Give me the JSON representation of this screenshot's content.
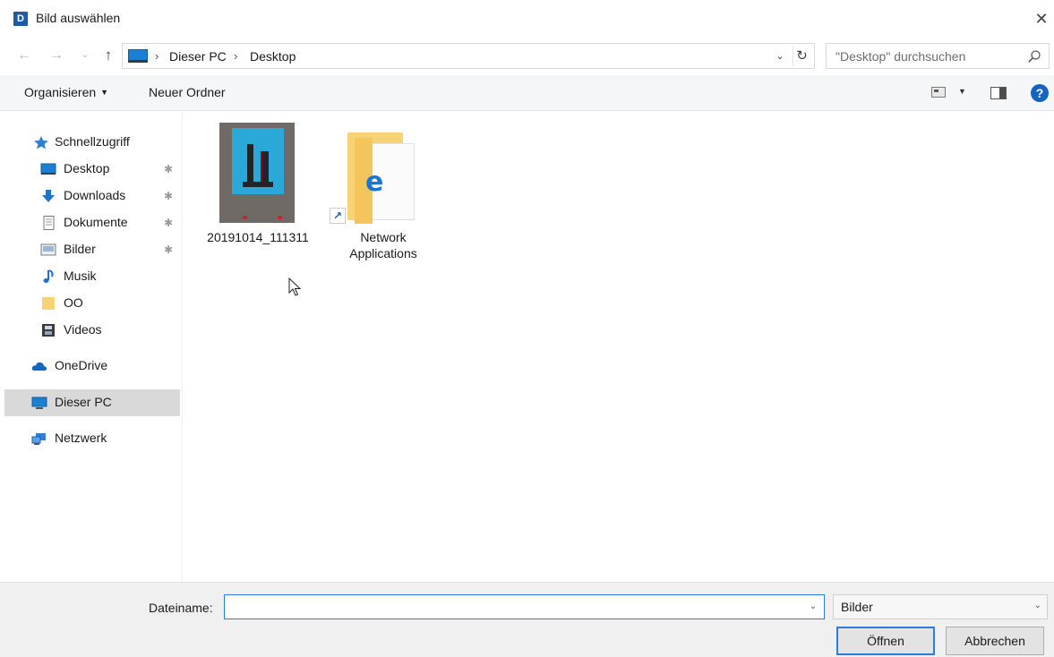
{
  "window": {
    "app_icon_letter": "D",
    "title": "Bild auswählen",
    "close_glyph": "✕"
  },
  "address": {
    "back_glyph": "←",
    "forward_glyph": "→",
    "recent_glyph": "⌄",
    "up_glyph": "↑",
    "breadcrumb": [
      "Dieser PC",
      "Desktop"
    ],
    "separator": "›",
    "dropdown_glyph": "⌄",
    "refresh_glyph": "↻",
    "search_placeholder": "\"Desktop\" durchsuchen"
  },
  "toolbar": {
    "organize_label": "Organisieren",
    "organize_caret": "▼",
    "new_folder_label": "Neuer Ordner",
    "view_caret": "▼",
    "help_glyph": "?"
  },
  "sidebar": {
    "items": [
      {
        "label": "Schnellzugriff",
        "icon": "star-icon"
      },
      {
        "label": "Desktop",
        "icon": "desktop-icon",
        "pinned": true
      },
      {
        "label": "Downloads",
        "icon": "download-icon",
        "pinned": true
      },
      {
        "label": "Dokumente",
        "icon": "document-icon",
        "pinned": true
      },
      {
        "label": "Bilder",
        "icon": "pictures-icon",
        "pinned": true
      },
      {
        "label": "Musik",
        "icon": "music-icon"
      },
      {
        "label": "OO",
        "icon": "folder-icon"
      },
      {
        "label": "Videos",
        "icon": "video-icon"
      },
      {
        "label": "OneDrive",
        "icon": "cloud-icon"
      },
      {
        "label": "Dieser PC",
        "icon": "pc-icon",
        "selected": true
      },
      {
        "label": "Netzwerk",
        "icon": "network-icon"
      }
    ],
    "pin_glyph": "✱"
  },
  "files": [
    {
      "name": "20191014_111311",
      "type": "image"
    },
    {
      "name": "Network Applications",
      "name_line1": "Network",
      "name_line2": "Applications",
      "type": "shortcut-folder"
    }
  ],
  "footer": {
    "filename_label": "Dateiname:",
    "filename_value": "",
    "filename_dropdown": "⌄",
    "filter_value": "Bilder",
    "filter_caret": "⌄",
    "open_label": "Öffnen",
    "cancel_label": "Abbrechen"
  },
  "colors": {
    "accent": "#2d7be0",
    "selection": "#d9d9d9",
    "folder": "#f6d476",
    "help": "#1565c0"
  }
}
